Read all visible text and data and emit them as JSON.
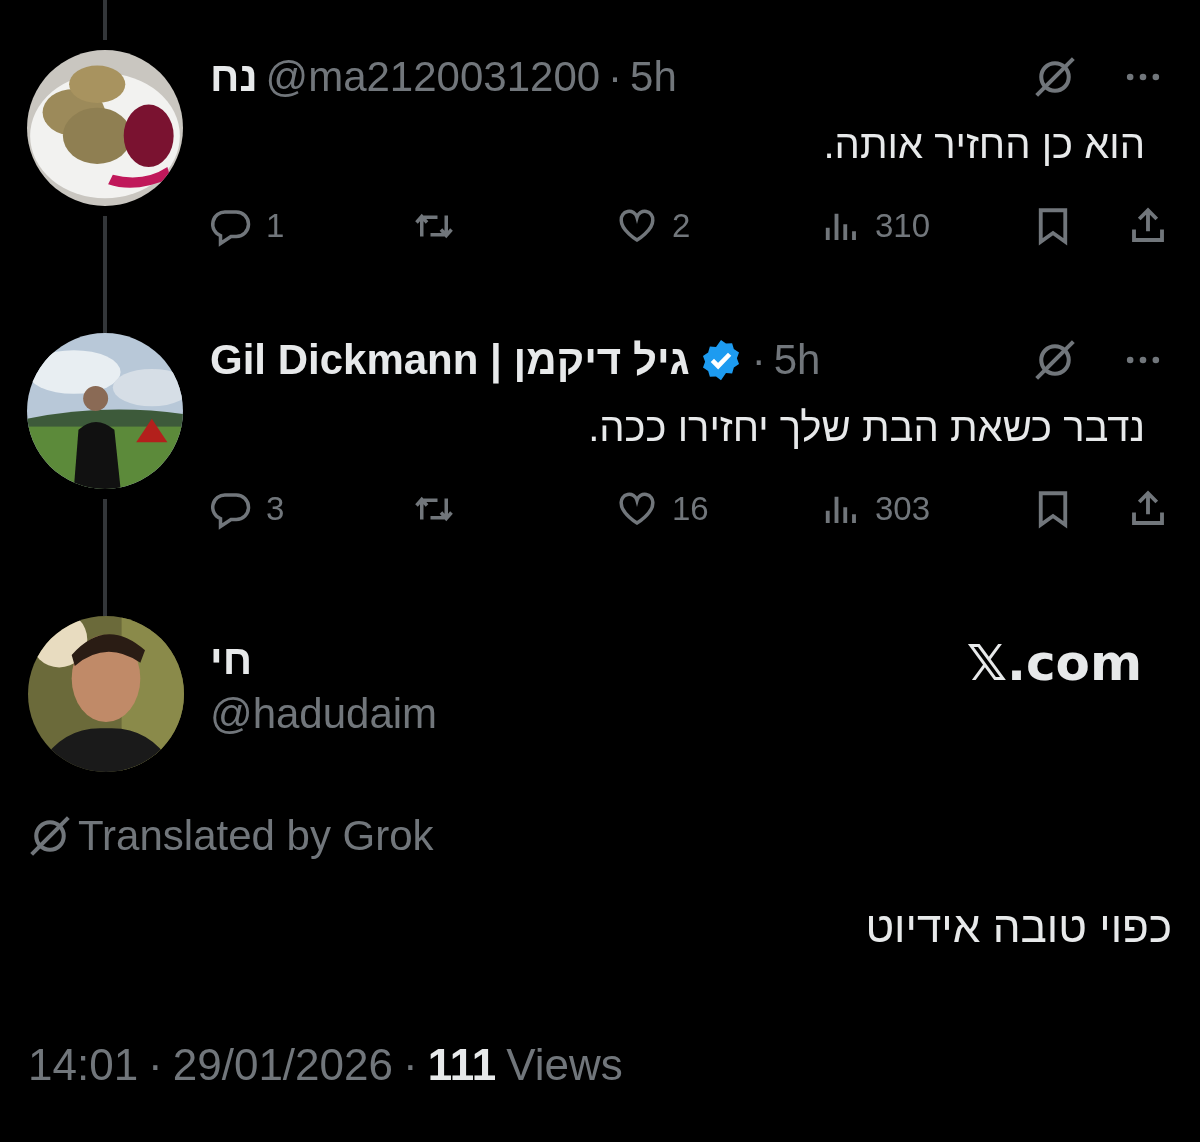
{
  "replies": [
    {
      "name": "נח",
      "handle": "@ma2120031200",
      "separator": "·",
      "time": "5h",
      "verified": false,
      "text": "הוא כן החזיר אותה.",
      "stats": {
        "replies": "1",
        "likes": "2",
        "views": "310"
      }
    },
    {
      "name": "Gil Dickmann | גיל דיקמן",
      "separator": "·",
      "time": "5h",
      "verified": true,
      "text": "נדבר כשאת הבת שלך יחזירו ככה.",
      "stats": {
        "replies": "3",
        "likes": "16",
        "views": "303"
      }
    }
  ],
  "main_tweet": {
    "name": "חי",
    "handle": "@hadudaim",
    "source": "𝕏.com",
    "translated_by": "Translated by Grok",
    "text": "כפוי טובה אידיוט",
    "time": "14:01",
    "separator_1": "·",
    "date": "29/01/2026",
    "separator_2": "·",
    "views_count": "111",
    "views_label": "Views"
  }
}
